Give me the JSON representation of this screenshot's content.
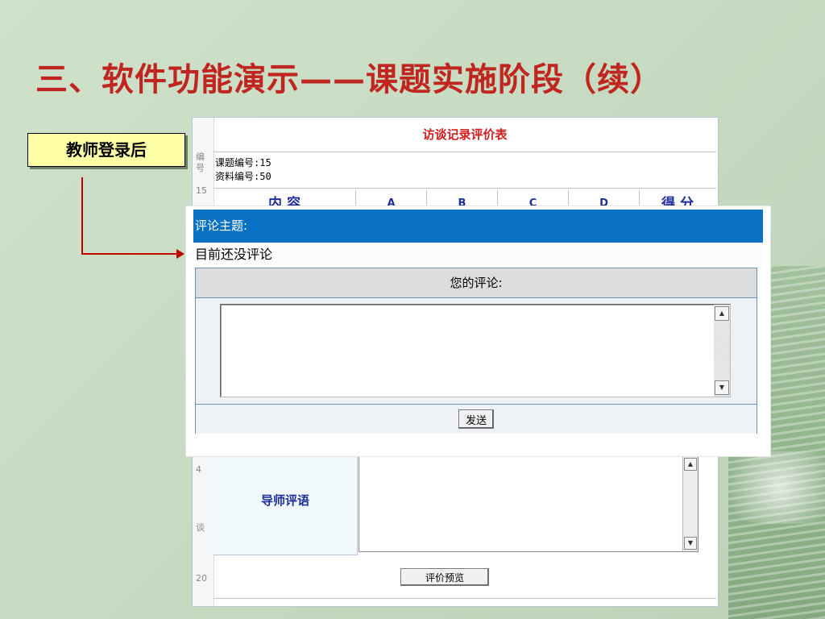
{
  "slide": {
    "title": "三、软件功能演示——课题实施阶段（续）",
    "callout": "教师登录后"
  },
  "background_form": {
    "title": "访谈记录评价表",
    "topic_number": "课题编号:15",
    "material_number": "资料编号:50",
    "left_strip": [
      "编",
      "号",
      "15",
      "4",
      "谈",
      "20"
    ],
    "columns": [
      "内 容",
      "A",
      "B",
      "C",
      "D",
      "得 分"
    ],
    "comment_label": "导师评语",
    "preview_button": "评价预览"
  },
  "popup": {
    "header": "评论主题:",
    "status": "目前还没评论",
    "panel_title": "您的评论:",
    "comment_value": "",
    "send_button": "发送"
  }
}
